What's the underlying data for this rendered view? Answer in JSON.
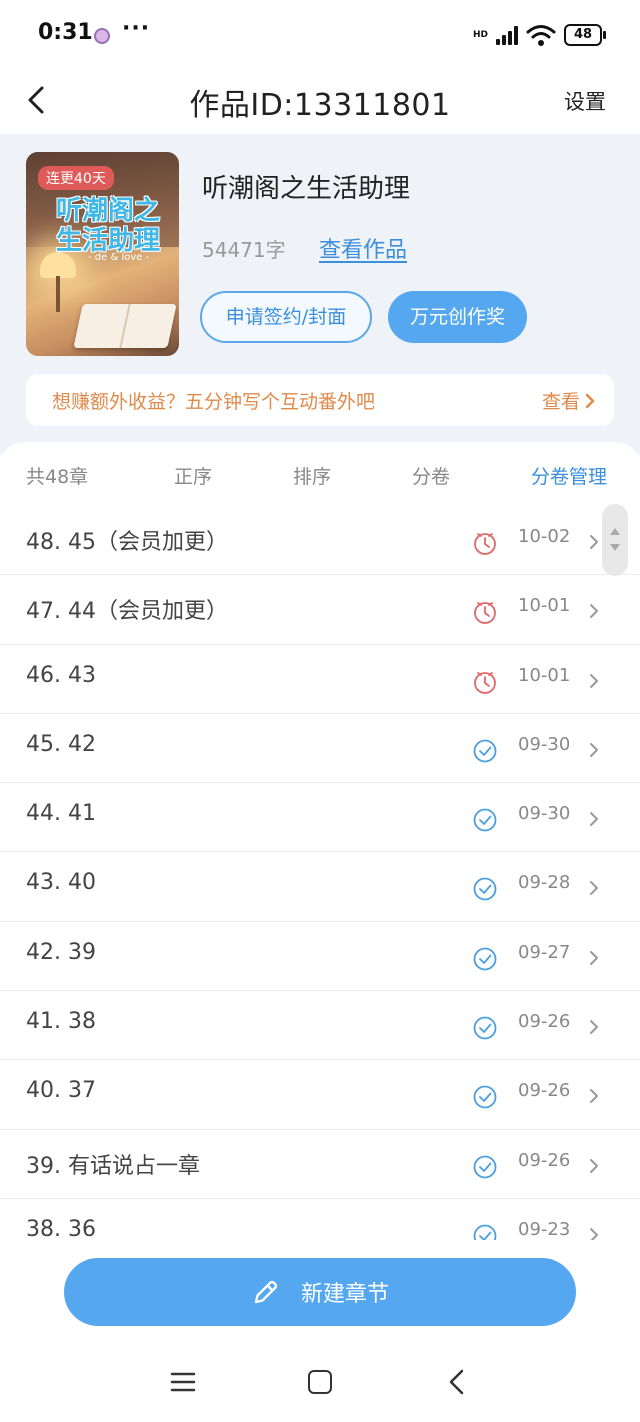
{
  "status_bar": {
    "time": "0:31",
    "more": "···",
    "network": "HD",
    "battery": "48"
  },
  "header": {
    "title": "作品ID:13311801",
    "settings": "设置"
  },
  "work": {
    "cover_title": "听潮阁之生活助理",
    "cover_subtitle": "- de & love -",
    "streak_badge": "连更40天",
    "title": "听潮阁之生活助理",
    "word_count": "54471字",
    "view_link": "查看作品",
    "sign_button": "申请签约/封面",
    "award_button": "万元创作奖"
  },
  "promo": {
    "text": "想赚额外收益？五分钟写个互动番外吧",
    "link": "查看"
  },
  "toolbar": {
    "count": "共48章",
    "asc": "正序",
    "sort": "排序",
    "volume": "分卷",
    "manage": "分卷管理"
  },
  "chapters": [
    {
      "title": "48. 45（会员加更）",
      "status": "pending",
      "date": "10-02"
    },
    {
      "title": "47. 44（会员加更）",
      "status": "pending",
      "date": "10-01"
    },
    {
      "title": "46. 43",
      "status": "pending",
      "date": "10-01"
    },
    {
      "title": "45. 42",
      "status": "published",
      "date": "09-30"
    },
    {
      "title": "44. 41",
      "status": "published",
      "date": "09-30"
    },
    {
      "title": "43. 40",
      "status": "published",
      "date": "09-28"
    },
    {
      "title": "42. 39",
      "status": "published",
      "date": "09-27"
    },
    {
      "title": "41. 38",
      "status": "published",
      "date": "09-26"
    },
    {
      "title": "40. 37",
      "status": "published",
      "date": "09-26"
    },
    {
      "title": "39. 有话说占一章",
      "status": "published",
      "date": "09-26"
    },
    {
      "title": "38. 36",
      "status": "published",
      "date": "09-23"
    }
  ],
  "new_chapter": {
    "label": "新建章节"
  },
  "colors": {
    "accent": "#55a8f0",
    "link": "#3a8fdc",
    "promo": "#e08a4a",
    "pending": "#e06868",
    "published": "#4a9fe0"
  },
  "icons": {
    "pending": "clock-icon",
    "published": "check-circle-icon",
    "new_chapter": "pencil-icon"
  }
}
